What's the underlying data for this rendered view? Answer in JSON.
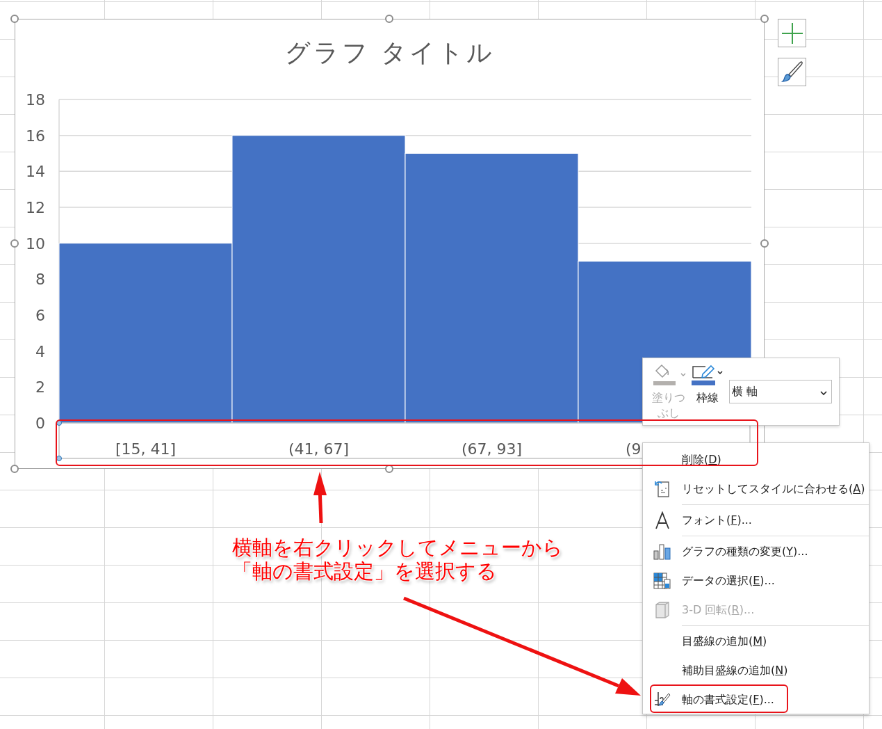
{
  "chart": {
    "chart_data": {
      "type": "bar",
      "title": "グラフ タイトル",
      "categories": [
        "[15, 41]",
        "(41, 67]",
        "(67, 93]",
        "(9"
      ],
      "values": [
        10,
        16,
        15,
        9
      ],
      "ylim": [
        0,
        18
      ],
      "grid": true,
      "yticks": [
        0,
        2,
        4,
        6,
        8,
        10,
        12,
        14,
        16,
        18
      ]
    }
  },
  "mini_toolbar": {
    "buttons": [
      {
        "label": "塗りつぶし",
        "disabled": true
      },
      {
        "label": "枠線",
        "disabled": false
      }
    ],
    "element_select": {
      "value": "横 軸"
    }
  },
  "context_menu": {
    "items": [
      {
        "kind": "item",
        "label": "削除(D)",
        "disabled": false
      },
      {
        "kind": "item",
        "label": "リセットしてスタイルに合わせる(A)",
        "disabled": false
      },
      {
        "kind": "separator"
      },
      {
        "kind": "item",
        "label": "フォント(F)...",
        "disabled": false
      },
      {
        "kind": "separator"
      },
      {
        "kind": "item",
        "label": "グラフの種類の変更(Y)...",
        "disabled": false
      },
      {
        "kind": "item",
        "label": "データの選択(E)...",
        "disabled": false
      },
      {
        "kind": "item",
        "label": "3-D 回転(R)...",
        "disabled": true
      },
      {
        "kind": "separator"
      },
      {
        "kind": "item",
        "label": "目盛線の追加(M)",
        "disabled": false
      },
      {
        "kind": "item",
        "label": "補助目盛線の追加(N)",
        "disabled": false
      },
      {
        "kind": "item",
        "label": "軸の書式設定(F)...",
        "disabled": false
      }
    ]
  },
  "annotation": {
    "lines": [
      "横軸を右クリックしてメニューから",
      "「軸の書式設定」を選択する"
    ]
  }
}
